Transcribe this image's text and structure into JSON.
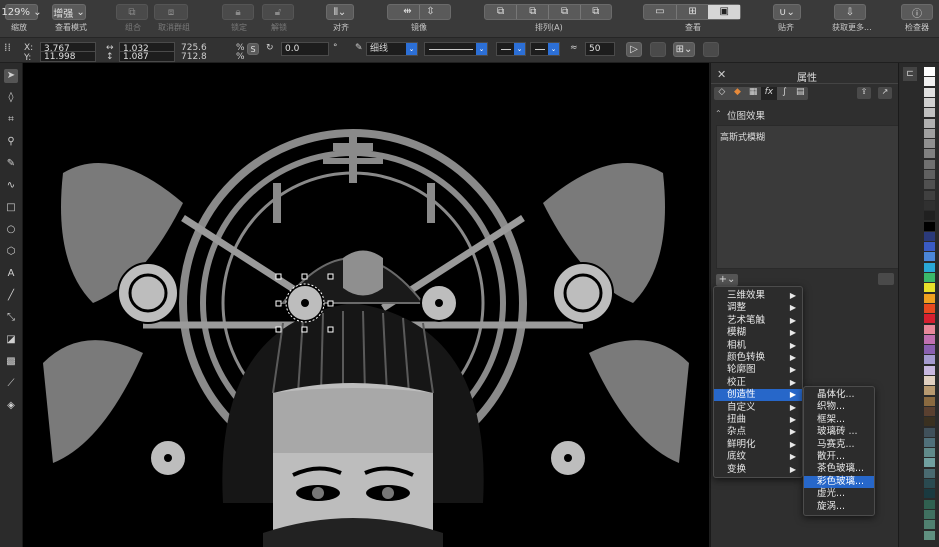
{
  "toolbar": {
    "zoom": "129%",
    "view_mode": "增强",
    "labels": [
      "缩放",
      "查看模式",
      "组合",
      "取消群组",
      "锁定",
      "解锁",
      "对齐",
      "镜像",
      "排列(A)",
      "查看",
      "贴齐",
      "获取更多...",
      "检查器"
    ]
  },
  "propbar": {
    "x_label": "X:",
    "x": "3.767",
    "y_label": "Y:",
    "y": "11.998",
    "w": "1.032",
    "h": "1.087",
    "sx": "725.6",
    "sy": "712.8",
    "pct": "%",
    "lock": "S",
    "rotation": "0.0",
    "deg": "°",
    "outline": "细线",
    "transparency": "50"
  },
  "panel": {
    "title": "属性",
    "section": "位图效果",
    "effect_item": "高斯式模糊",
    "add_button": "+"
  },
  "menu_effects": {
    "items": [
      "三维效果",
      "调整",
      "艺术笔触",
      "模糊",
      "相机",
      "颜色转换",
      "轮廓图",
      "校正",
      "创造性",
      "自定义",
      "扭曲",
      "杂点",
      "鲜明化",
      "底纹",
      "变换"
    ],
    "selected": "创造性"
  },
  "menu_creative": {
    "items": [
      "晶体化...",
      "织物...",
      "框架...",
      "玻璃砖 ...",
      "马赛克...",
      "散开...",
      "茶色玻璃...",
      "彩色玻璃...",
      "虚光...",
      "旋涡..."
    ],
    "selected": "彩色玻璃..."
  },
  "palette": [
    "#ffffff",
    "#f0f0f0",
    "#e0e0e0",
    "#d0d0d0",
    "#c0c0c0",
    "#b0b0b0",
    "#a0a0a0",
    "#909090",
    "#808080",
    "#707070",
    "#606060",
    "#505050",
    "#404040",
    "#303030",
    "#202020",
    "#000000",
    "#2b3a7a",
    "#3a5bc4",
    "#4b86d8",
    "#29a7d6",
    "#3bb86a",
    "#e8e02a",
    "#f0a020",
    "#e84a20",
    "#d62030",
    "#e8889a",
    "#c070b0",
    "#8a60b0",
    "#a59bd0",
    "#c8b8e0",
    "#e0d0c0",
    "#b89a70",
    "#8a6a40",
    "#5a4030",
    "#3a3020",
    "#40505a",
    "#50707a",
    "#608a8a",
    "#70a0a0",
    "#4a6a70",
    "#2a4a50",
    "#1a3a40",
    "#306050",
    "#407060",
    "#508070",
    "#609080"
  ]
}
